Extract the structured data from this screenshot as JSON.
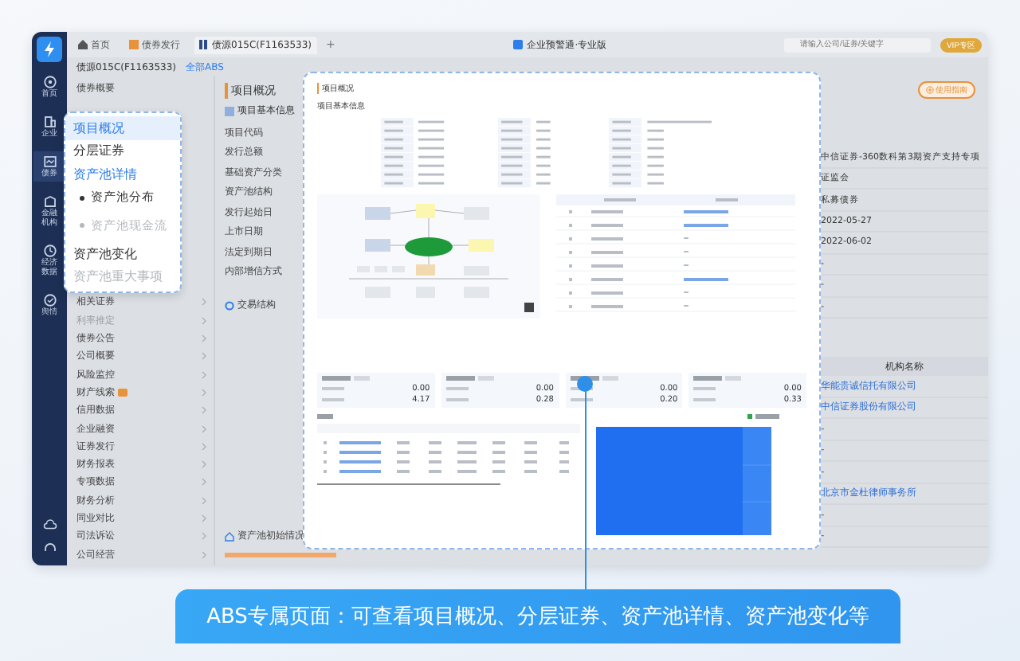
{
  "rail": [
    {
      "label": "首页",
      "selected": false
    },
    {
      "label": "企业",
      "selected": false
    },
    {
      "label": "债券",
      "selected": true
    },
    {
      "label": "金融机构",
      "selected": false
    },
    {
      "label": "经济数据",
      "selected": false
    },
    {
      "label": "舆情",
      "selected": false
    }
  ],
  "top_tabs": [
    {
      "label": "首页",
      "selected": false
    },
    {
      "label": "债券发行",
      "selected": false
    },
    {
      "label": "债源015C(F1163533)",
      "selected": true
    }
  ],
  "add_tab": "+",
  "app_title": "企业预警通·专业版",
  "search": {
    "placeholder": "请输入公司/证券/关键字"
  },
  "vip_button": "VIP专区",
  "security": {
    "title": "债源015C(F1163533)",
    "link": "全部ABS"
  },
  "nav_top": [
    {
      "label": "债券概要"
    }
  ],
  "nav": [
    {
      "label": "相关证券",
      "disabled": false,
      "badge": false
    },
    {
      "label": "利率推定",
      "disabled": true,
      "badge": false
    },
    {
      "label": "债券公告",
      "disabled": false,
      "badge": false
    },
    {
      "label": "公司概要",
      "disabled": false,
      "badge": false
    },
    {
      "label": "风险监控",
      "disabled": false,
      "badge": false
    },
    {
      "label": "财产线索",
      "disabled": false,
      "badge": true
    },
    {
      "label": "信用数据",
      "disabled": false,
      "badge": false
    },
    {
      "label": "企业融资",
      "disabled": false,
      "badge": false
    },
    {
      "label": "证券发行",
      "disabled": false,
      "badge": false
    },
    {
      "label": "财务报表",
      "disabled": false,
      "badge": false
    },
    {
      "label": "专项数据",
      "disabled": false,
      "badge": false
    },
    {
      "label": "财务分析",
      "disabled": false,
      "badge": false
    },
    {
      "label": "同业对比",
      "disabled": false,
      "badge": false
    },
    {
      "label": "司法诉讼",
      "disabled": false,
      "badge": false
    },
    {
      "label": "公司经营",
      "disabled": false,
      "badge": false
    }
  ],
  "callout_menu": [
    {
      "label": "项目概况",
      "kind": "item",
      "selected": true,
      "disabled": false
    },
    {
      "label": "分层证券",
      "kind": "item",
      "selected": false,
      "disabled": false
    },
    {
      "label": "资产池详情",
      "kind": "group",
      "selected": false,
      "disabled": false,
      "expanded": true
    },
    {
      "label": "资产池分布",
      "kind": "sub",
      "selected": false,
      "disabled": false
    },
    {
      "label": "资产池现金流",
      "kind": "sub",
      "selected": false,
      "disabled": true
    },
    {
      "label": "资产池变化",
      "kind": "item",
      "selected": false,
      "disabled": false
    },
    {
      "label": "资产池重大事项",
      "kind": "item",
      "selected": false,
      "disabled": true
    }
  ],
  "overview": {
    "title": "项目概况",
    "subtitle": "项目基本信息",
    "fields": [
      "项目代码",
      "发行总额",
      "基础资产分类",
      "资产池结构",
      "发行起始日",
      "上市日期",
      "法定到期日",
      "内部增信方式"
    ],
    "structure_title": "交易结构",
    "pool_title": "资产池初始情况"
  },
  "guide_button": "使用指南",
  "values": [
    "中信证券-360数科第3期资产支持专项",
    "证监会",
    "私募债券",
    "2022-05-27",
    "2022-06-02",
    "-",
    "-",
    "-"
  ],
  "institutions": {
    "header": "机构名称",
    "rows": [
      "华能贵诚信托有限公司",
      "中信证券股份有限公司",
      "-",
      "-",
      "-",
      "北京市金杜律师事务所",
      "-",
      "-"
    ]
  },
  "card": {
    "title": "项目概况",
    "subtitle": "项目基本信息",
    "tranches": [
      {
        "values": [
          "0.00",
          "4.17"
        ]
      },
      {
        "values": [
          "0.00",
          "0.28"
        ]
      },
      {
        "values": [
          "0.00",
          "0.20"
        ]
      },
      {
        "values": [
          "0.00",
          "0.33"
        ]
      }
    ]
  },
  "caption": "ABS专属页面：可查看项目概况、分层证券、资产池详情、资产池变化等"
}
